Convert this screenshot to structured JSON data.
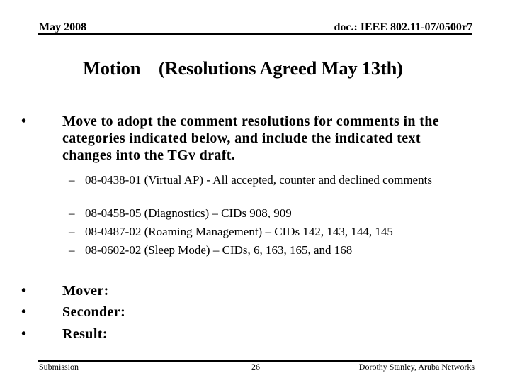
{
  "header": {
    "date": "May 2008",
    "doc_id": "doc.: IEEE 802.11-07/0500r7"
  },
  "title": "Motion    (Resolutions Agreed May 13th)",
  "body": {
    "bullet_glyph": "•",
    "dash_glyph": "–",
    "main_bullet": "Move to adopt the comment resolutions for comments in the categories indicated below, and include the indicated text changes into the TGv draft.",
    "sub_items": [
      "08-0438-01 (Virtual AP) - All accepted, counter and declined comments",
      "08-0458-05 (Diagnostics) – CIDs 908, 909",
      "08-0487-02 (Roaming Management) – CIDs 142, 143, 144, 145",
      "08-0602-02 (Sleep Mode) – CIDs, 6, 163, 165, and 168"
    ],
    "vote_items": [
      "Mover:",
      "Seconder:",
      "Result:"
    ]
  },
  "footer": {
    "left": "Submission",
    "page_number": "26",
    "author": "Dorothy Stanley, Aruba Networks"
  }
}
